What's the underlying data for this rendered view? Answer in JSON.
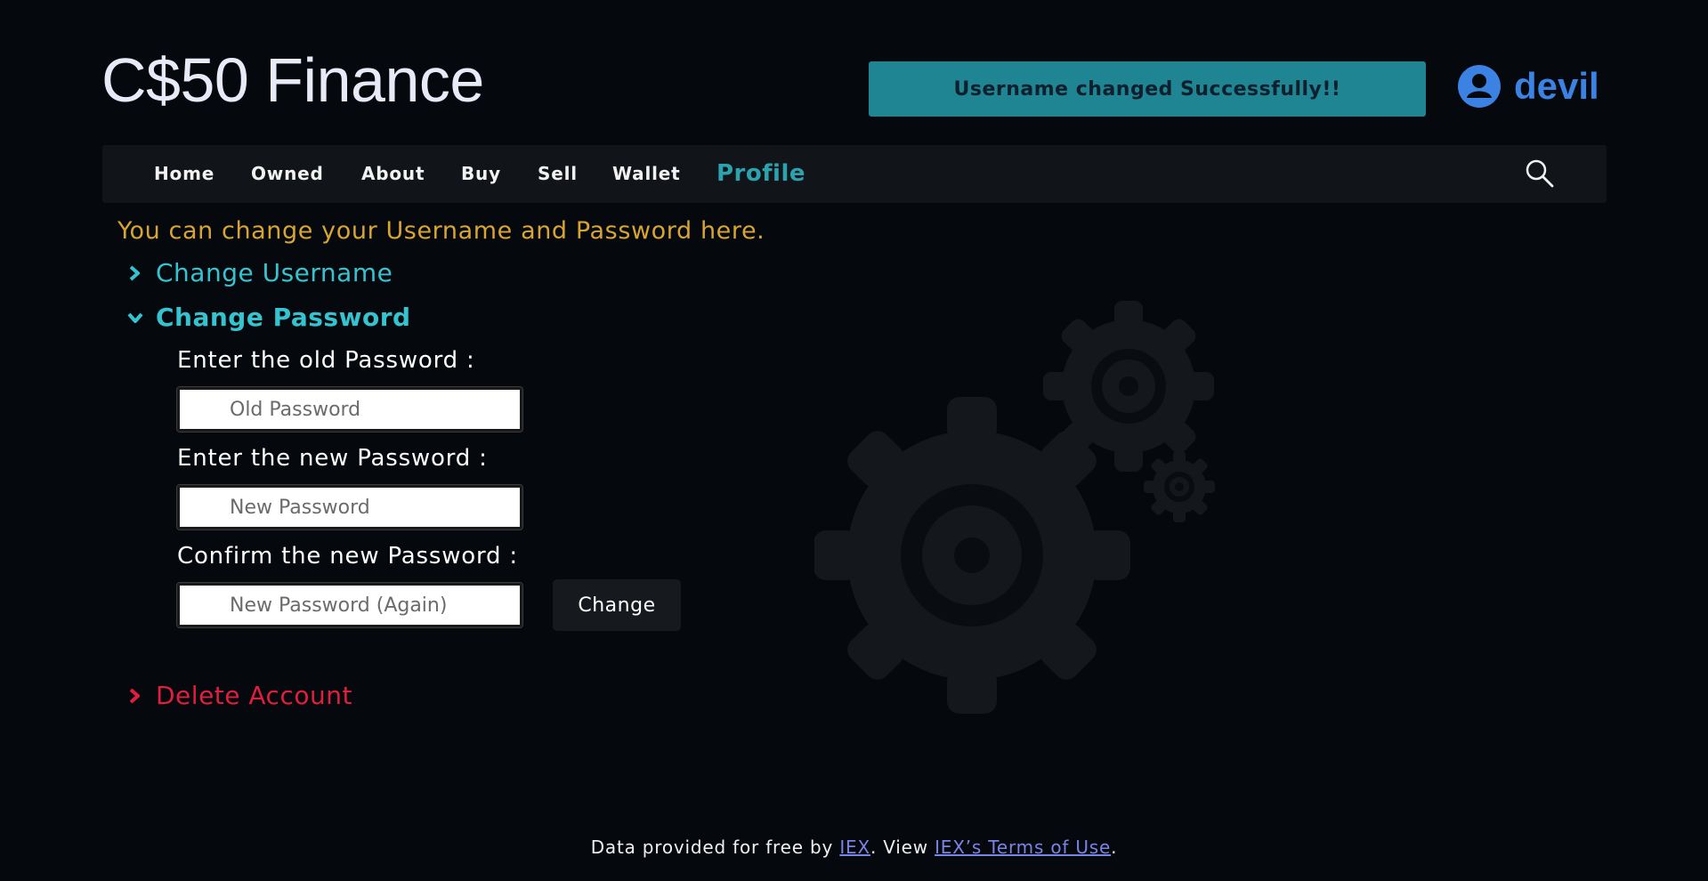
{
  "brand": {
    "title": "C$50 Finance"
  },
  "flash": {
    "message": "Username changed Successfully!!"
  },
  "user": {
    "name": "devil",
    "icon": "user-circle-icon"
  },
  "nav": {
    "items": [
      "Home",
      "Owned",
      "About",
      "Buy",
      "Sell",
      "Wallet"
    ],
    "active": "Profile",
    "search_icon": "search-icon"
  },
  "profile": {
    "intro": "You can change your Username and Password here.",
    "change_username": {
      "label": "Change Username",
      "expanded": false
    },
    "change_password": {
      "label": "Change Password",
      "expanded": true,
      "old_label": "Enter the old Password :",
      "old_placeholder": "Old Password",
      "new_label": "Enter the new Password :",
      "new_placeholder": "New Password",
      "confirm_label": "Confirm the new Password :",
      "confirm_placeholder": "New Password (Again)",
      "submit": "Change"
    },
    "delete_account": {
      "label": "Delete Account",
      "expanded": false
    }
  },
  "footer": {
    "prefix": "Data provided for free by",
    "iex": "IEX",
    "middle": ". View",
    "terms": "IEX’s Terms of Use",
    "suffix": "."
  },
  "colors": {
    "background": "#05080d",
    "accent": "#2ca2ae",
    "flash": "#1f8592",
    "intro": "#d8a534",
    "danger": "#e01e3d",
    "user": "#3b82e3"
  }
}
